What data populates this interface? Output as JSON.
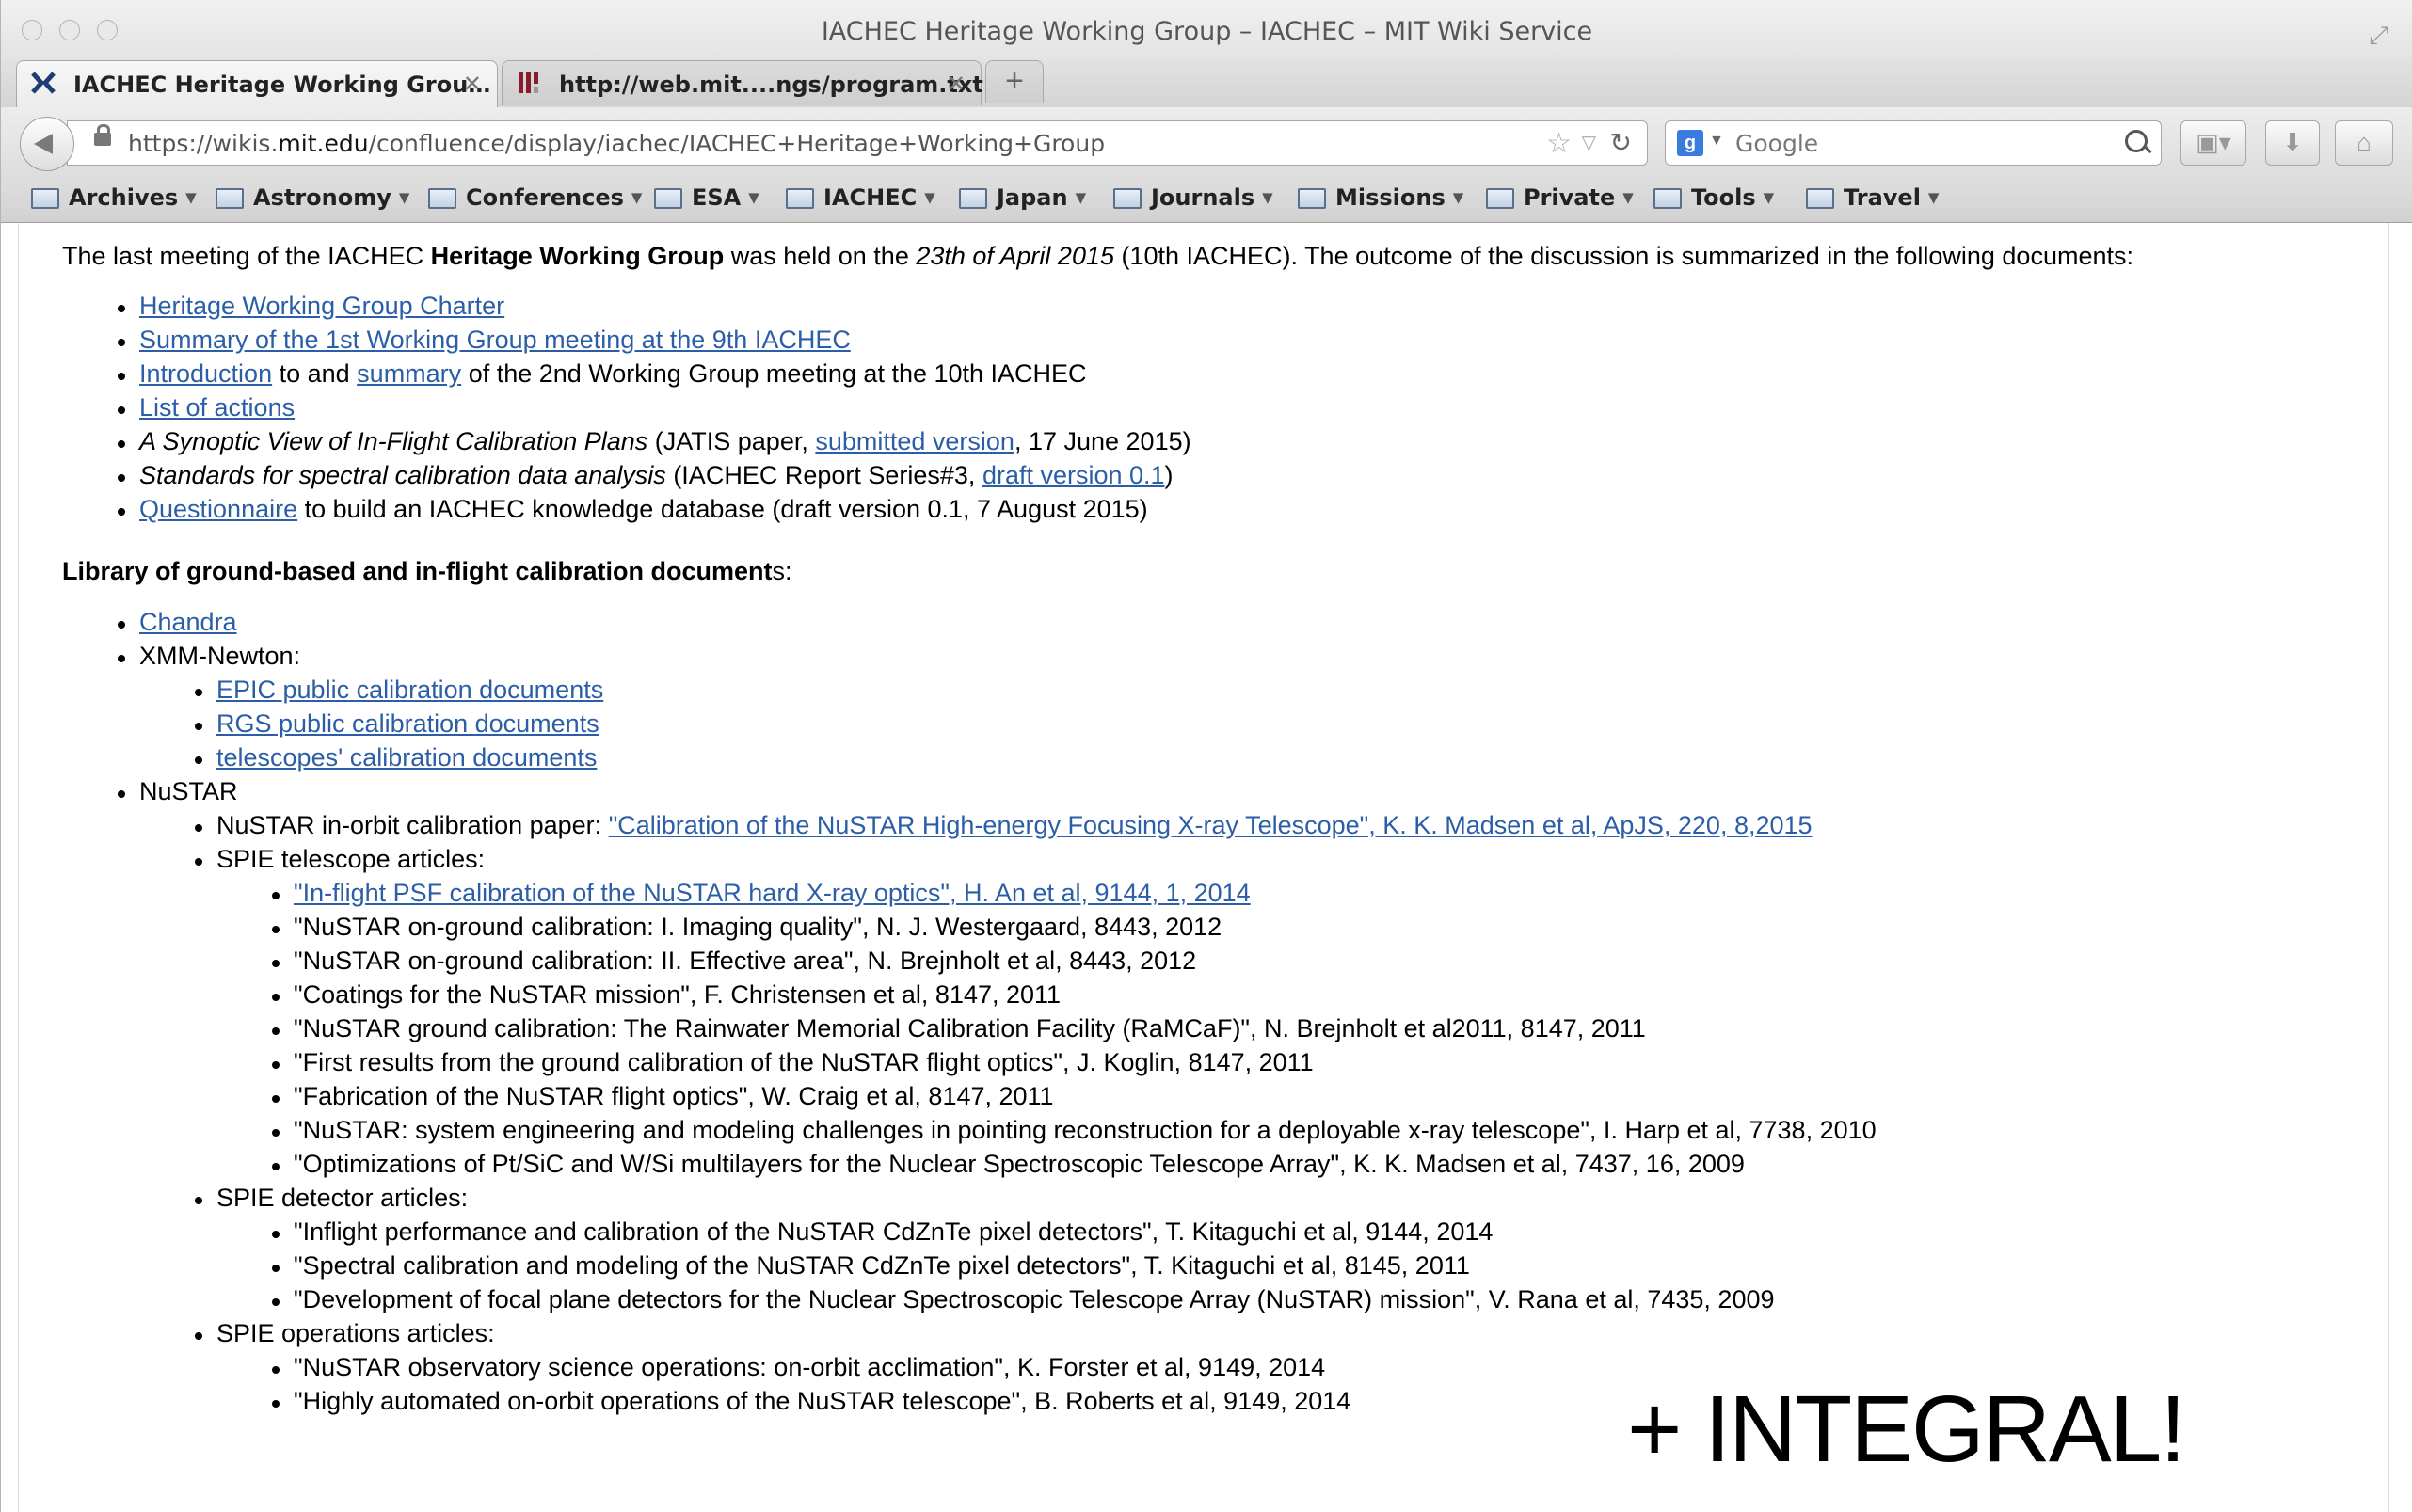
{
  "window": {
    "title": "IACHEC Heritage Working Group – IACHEC – MIT Wiki Service"
  },
  "tabs": [
    {
      "label": "IACHEC Heritage Working Grou…",
      "active": true
    },
    {
      "label": "http://web.mit....ngs/program.txt",
      "active": false
    }
  ],
  "newtab_label": "+",
  "address": {
    "prefix": "https://wikis.",
    "domain": "mit.edu",
    "suffix": "/confluence/display/iachec/IACHEC+Heritage+Working+Group"
  },
  "search": {
    "placeholder": "Google"
  },
  "bookmarks": [
    "Archives",
    "Astronomy",
    "Conferences",
    "ESA",
    "IACHEC",
    "Japan",
    "Journals",
    "Missions",
    "Private",
    "Tools",
    "Travel"
  ],
  "intro": {
    "p1": "The last meeting of the IACHEC ",
    "bold": "Heritage Working Group",
    "p2": " was held on the ",
    "italic": "23th of April 2015",
    "p3": " (10th IACHEC). The outcome of the discussion is summarized in the following documents:"
  },
  "documents": {
    "charter": "Heritage Working Group Charter",
    "summary1": "Summary of the 1st Working Group meeting at the 9th IACHEC",
    "intro_link": "Introduction",
    "to_and": " to and ",
    "summary_link": "summary",
    "of_2nd": " of the 2nd Working Group meeting at the 10th IACHEC",
    "actions": "List of actions",
    "synoptic_italic": "A Synoptic View of In-Flight Calibration Plans",
    "synoptic_rest": " (JATIS paper, ",
    "submitted": "submitted version",
    "synoptic_end": ", 17 June 2015)",
    "standards_italic": "Standards for spectral calibration data analysis",
    "standards_rest": " (IACHEC Report Series#3, ",
    "draft": "draft version 0.1",
    "standards_end": ")",
    "questionnaire": "Questionnaire",
    "questionnaire_rest": " to build an IACHEC knowledge database (draft version 0.1, 7 August 2015)"
  },
  "library": {
    "heading": "Library of ground-based and in-flight calibration document",
    "heading_tail": "s:",
    "chandra": "Chandra",
    "xmm": "XMM-Newton:",
    "xmm_items": [
      "EPIC public calibration documents",
      "RGS public calibration documents",
      "telescopes' calibration documents"
    ],
    "nustar": "NuSTAR",
    "inorbit_label": "NuSTAR in-orbit calibration paper: ",
    "inorbit_link": "\"Calibration of the NuSTAR High-energy Focusing X-ray Telescope\", K. K. Madsen et al, ApJS, 220, 8,2015",
    "spie_telescope": "SPIE telescope articles:",
    "telescope_link": "\"In-flight PSF calibration of the NuSTAR hard X-ray optics\", H. An et al, 9144, 1, 2014",
    "telescope_items": [
      "\"NuSTAR on-ground calibration: I. Imaging quality\", N. J. Westergaard, 8443, 2012",
      "\"NuSTAR on-ground calibration: II. Effective area\", N. Brejnholt et al, 8443, 2012",
      "\"Coatings for the NuSTAR mission\", F. Christensen et al, 8147, 2011",
      "\"NuSTAR ground calibration: The Rainwater Memorial Calibration Facility (RaMCaF)\", N. Brejnholt et al2011, 8147, 2011",
      "\"First results from the ground calibration of the NuSTAR flight optics\", J. Koglin, 8147, 2011",
      "\"Fabrication of the NuSTAR flight optics\", W. Craig et al, 8147, 2011",
      "\"NuSTAR: system engineering and modeling challenges in pointing reconstruction for a deployable x-ray telescope\", I. Harp et al, 7738, 2010",
      "\"Optimizations of Pt/SiC and W/Si multilayers for the Nuclear Spectroscopic Telescope Array\", K. K. Madsen et al, 7437, 16, 2009"
    ],
    "spie_detector": "SPIE detector articles:",
    "detector_items": [
      "\"Inflight performance and calibration of the NuSTAR CdZnTe pixel detectors\", T. Kitaguchi et al, 9144, 2014",
      "\"Spectral calibration and modeling of the NuSTAR CdZnTe pixel detectors\", T. Kitaguchi et al, 8145, 2011",
      "\"Development of focal plane detectors for the Nuclear Spectroscopic Telescope Array (NuSTAR) mission\", V. Rana et al, 7435, 2009"
    ],
    "spie_operations": "SPIE operations articles:",
    "operations_items": [
      "\"NuSTAR observatory science operations: on-orbit acclimation\", K. Forster et al, 9149, 2014",
      " \"Highly automated on-orbit operations of the NuSTAR telescope\", B. Roberts et al, 9149, 2014"
    ]
  },
  "overlay": "+ INTEGRAL!",
  "colors": {
    "link": "#2b5ea7",
    "chrome": "#dcdcdc"
  }
}
